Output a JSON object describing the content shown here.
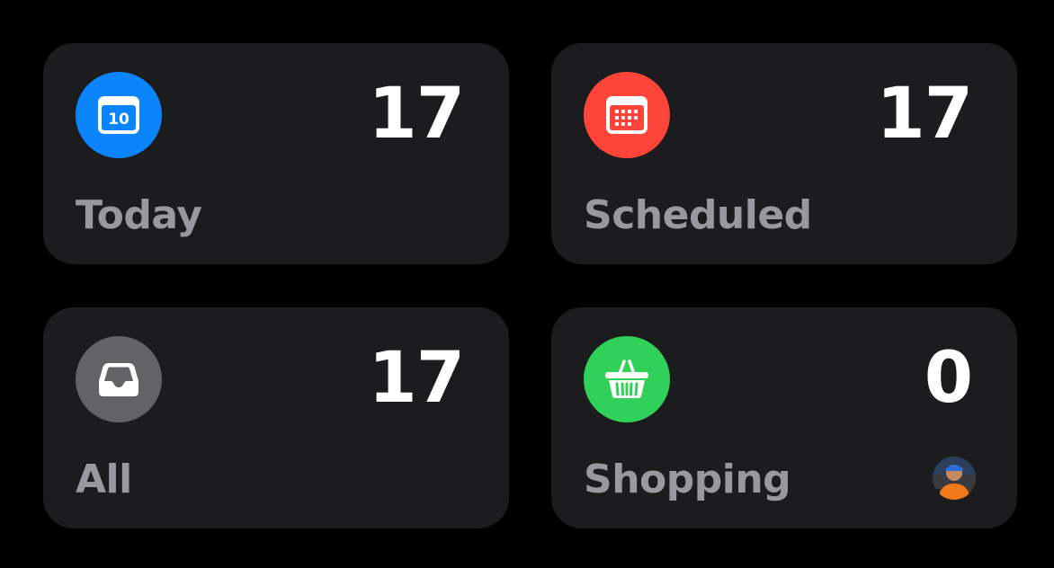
{
  "lists": [
    {
      "label": "Today",
      "count": "17",
      "icon": "calendar-today-icon",
      "color": "#0a84ff",
      "calendar_day": "10"
    },
    {
      "label": "Scheduled",
      "count": "17",
      "icon": "calendar-grid-icon",
      "color": "#ff453a"
    },
    {
      "label": "All",
      "count": "17",
      "icon": "tray-icon",
      "color": "#636366"
    },
    {
      "label": "Shopping",
      "count": "0",
      "icon": "basket-icon",
      "color": "#30d158",
      "shared_avatar": "shared-user-avatar"
    }
  ],
  "colors": {
    "background": "#000000",
    "card": "#1c1c1e",
    "count_text": "#ffffff",
    "label_text": "#98989f"
  }
}
